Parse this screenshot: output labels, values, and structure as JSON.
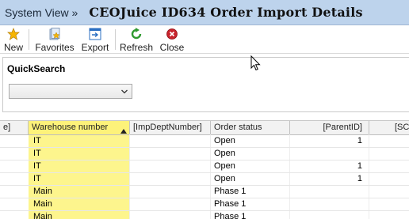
{
  "header": {
    "breadcrumb": "System View »",
    "title": "CEOJuice ID634 Order Import Details"
  },
  "toolbar": {
    "buttons": [
      {
        "label": "New",
        "icon": "star-icon"
      },
      {
        "label": "Favorites",
        "icon": "favorites-icon"
      },
      {
        "label": "Export",
        "icon": "export-icon"
      },
      {
        "label": "Refresh",
        "icon": "refresh-icon"
      },
      {
        "label": "Close",
        "icon": "close-icon"
      }
    ]
  },
  "quicksearch": {
    "label": "QuickSearch",
    "selected_value": ""
  },
  "grid": {
    "columns": [
      "e]",
      "Warehouse number",
      "[ImpDeptNumber]",
      "Order status",
      "[ParentID]",
      "[SC"
    ],
    "sorted_column": "Warehouse number",
    "rows": [
      {
        "warehouse": "IT",
        "dept": "",
        "status": "Open",
        "parent": "1"
      },
      {
        "warehouse": "IT",
        "dept": "",
        "status": "Open",
        "parent": ""
      },
      {
        "warehouse": "IT",
        "dept": "",
        "status": "Open",
        "parent": "1"
      },
      {
        "warehouse": "IT",
        "dept": "",
        "status": "Open",
        "parent": "1"
      },
      {
        "warehouse": "Main",
        "dept": "",
        "status": "Phase 1",
        "parent": ""
      },
      {
        "warehouse": "Main",
        "dept": "",
        "status": "Phase 1",
        "parent": ""
      },
      {
        "warehouse": "Main",
        "dept": "",
        "status": "Phase 1",
        "parent": ""
      }
    ]
  },
  "colors": {
    "titlebar_bg": "#bdd3ec",
    "sorted_column_highlight": "#fdf58d"
  }
}
